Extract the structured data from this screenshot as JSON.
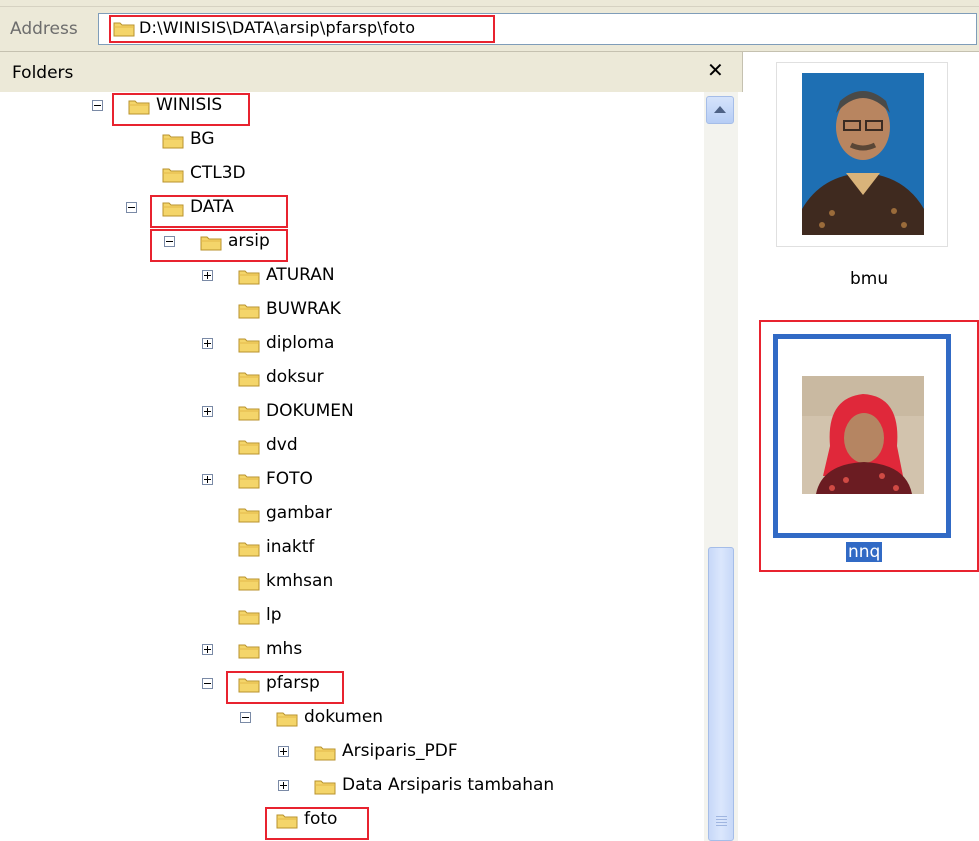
{
  "address_bar": {
    "label": "Address",
    "path": "D:\\WINISIS\\DATA\\arsip\\pfarsp\\foto"
  },
  "folders_panel": {
    "title": "Folders",
    "close_glyph": "✕"
  },
  "tree": [
    {
      "label": "WINISIS",
      "expander": "minus",
      "highlighted": true
    },
    {
      "label": "BG",
      "expander": "none"
    },
    {
      "label": "CTL3D",
      "expander": "none"
    },
    {
      "label": "DATA",
      "expander": "minus",
      "highlighted": true
    },
    {
      "label": "arsip",
      "expander": "minus",
      "highlighted": true
    },
    {
      "label": "ATURAN",
      "expander": "plus"
    },
    {
      "label": "BUWRAK",
      "expander": "none"
    },
    {
      "label": "diploma",
      "expander": "plus"
    },
    {
      "label": "doksur",
      "expander": "none"
    },
    {
      "label": "DOKUMEN",
      "expander": "plus"
    },
    {
      "label": "dvd",
      "expander": "none"
    },
    {
      "label": "FOTO",
      "expander": "plus"
    },
    {
      "label": "gambar",
      "expander": "none"
    },
    {
      "label": "inaktf",
      "expander": "none"
    },
    {
      "label": "kmhsan",
      "expander": "none"
    },
    {
      "label": "lp",
      "expander": "none"
    },
    {
      "label": "mhs",
      "expander": "plus"
    },
    {
      "label": "pfarsp",
      "expander": "minus",
      "highlighted": true
    },
    {
      "label": "dokumen",
      "expander": "minus"
    },
    {
      "label": "Arsiparis_PDF",
      "expander": "plus"
    },
    {
      "label": "Data Arsiparis tambahan",
      "expander": "plus"
    },
    {
      "label": "foto",
      "expander": "none",
      "highlighted": true
    }
  ],
  "thumbnails": [
    {
      "caption": "bmu",
      "selected": false
    },
    {
      "caption": "nnq",
      "selected": true
    }
  ],
  "colors": {
    "highlight_red": "#e8232f",
    "selection_blue": "#316ac5",
    "folder_yellow": "#f4d56a"
  }
}
